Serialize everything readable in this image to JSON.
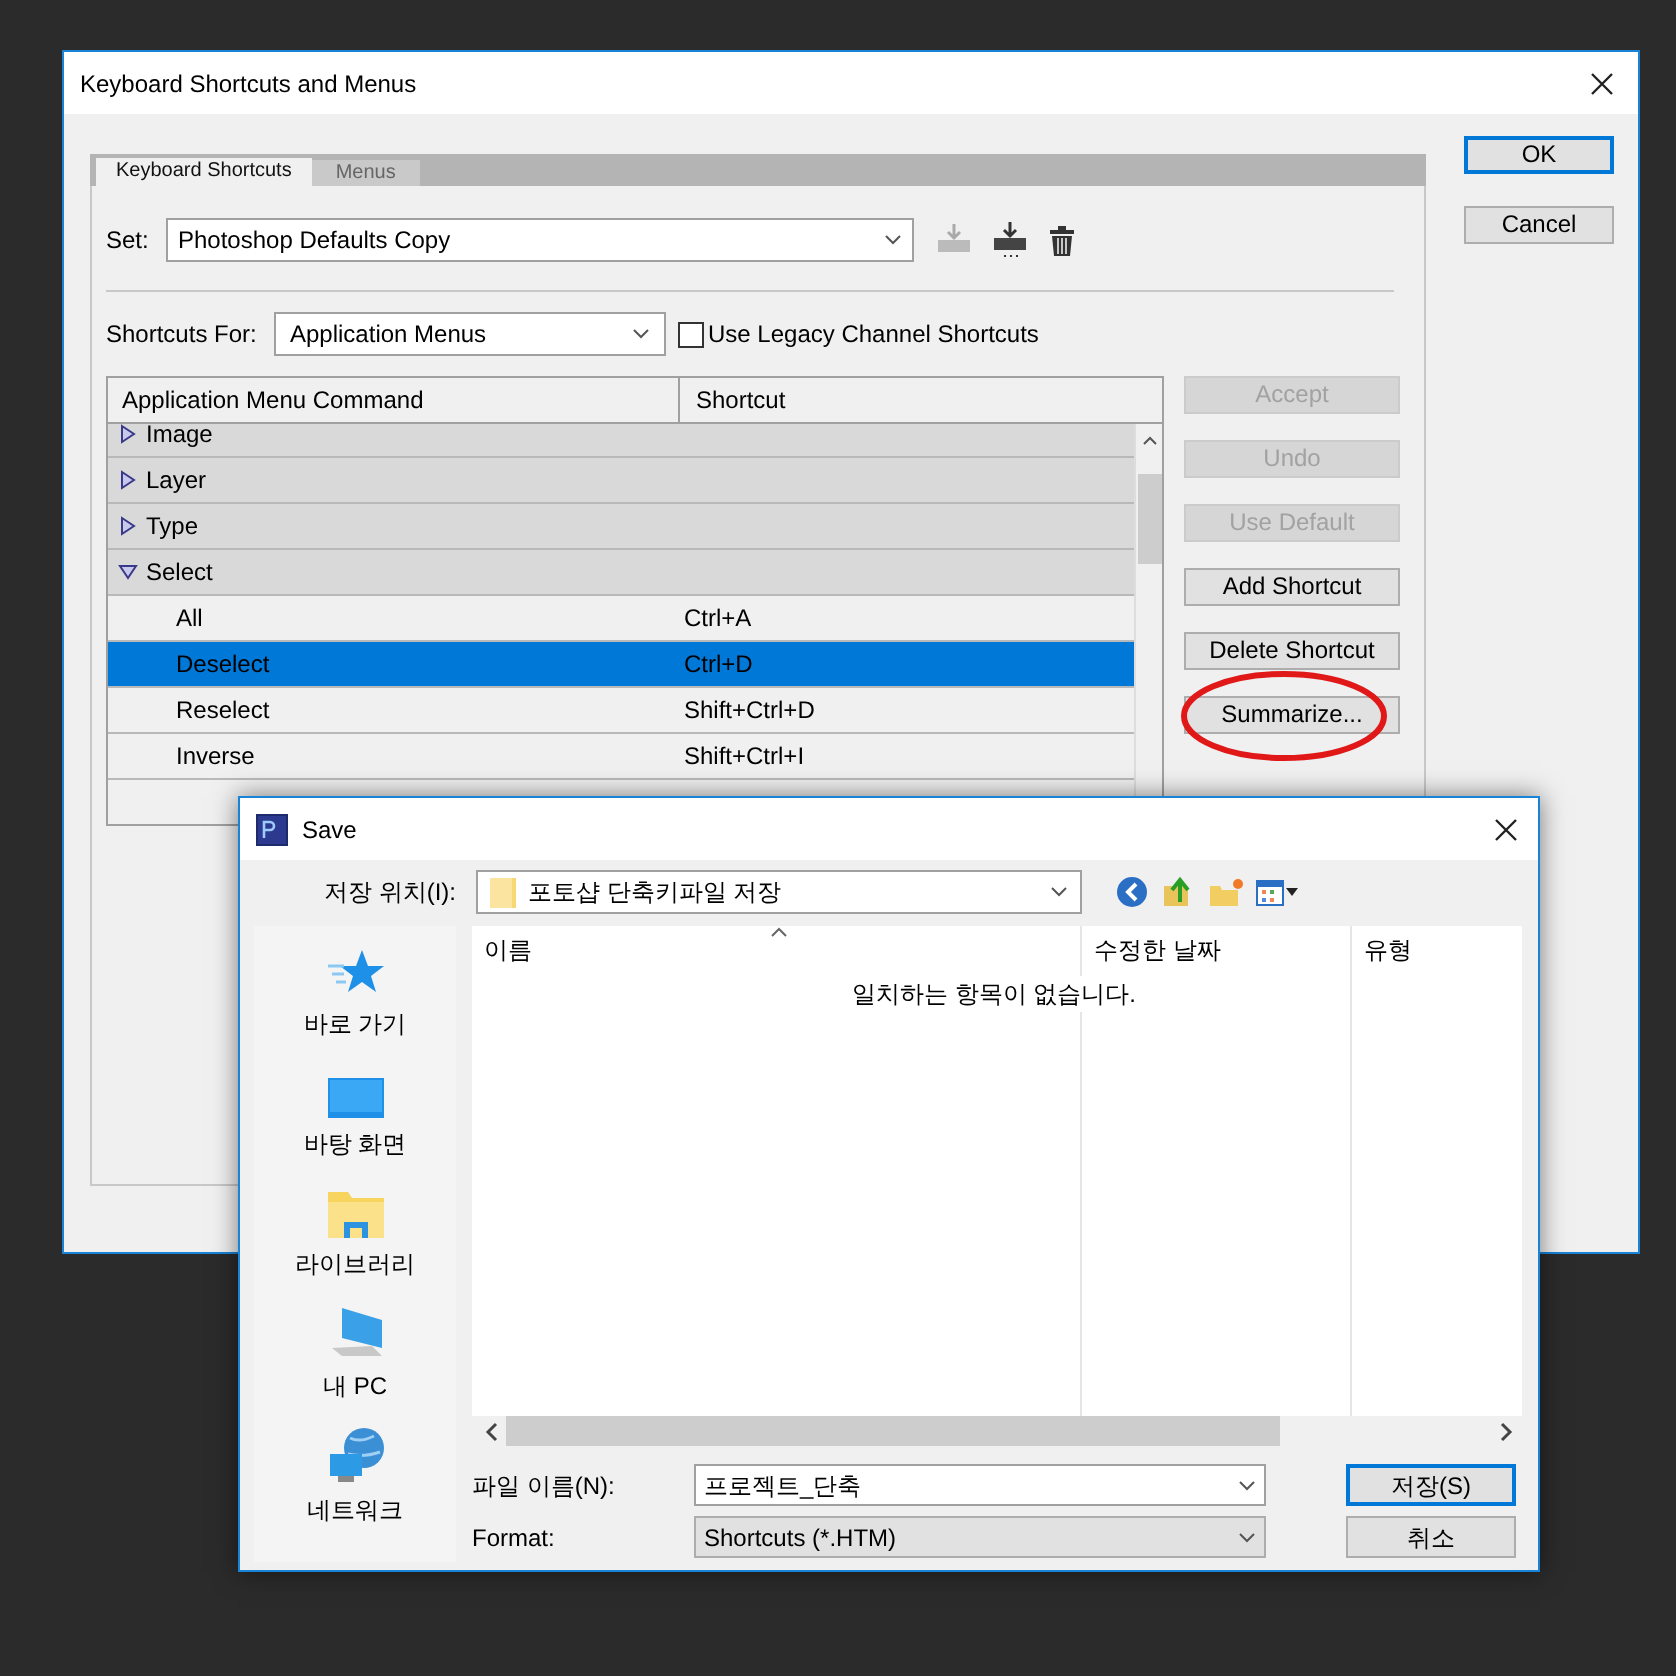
{
  "main_dialog": {
    "title": "Keyboard Shortcuts and Menus",
    "tabs": [
      {
        "label": "Keyboard Shortcuts",
        "selected": true
      },
      {
        "label": "Menus",
        "selected": false
      }
    ],
    "set": {
      "label": "Set:",
      "value": "Photoshop Defaults Copy"
    },
    "shortcuts_for": {
      "label": "Shortcuts For:",
      "value": "Application Menus"
    },
    "legacy_checkbox": {
      "label": "Use Legacy Channel Shortcuts",
      "checked": false
    },
    "table": {
      "columns": [
        "Application Menu Command",
        "Shortcut"
      ],
      "rows": [
        {
          "kind": "group",
          "command": "Image",
          "expanded": false,
          "selected": false
        },
        {
          "kind": "group",
          "command": "Layer",
          "expanded": false,
          "selected": false
        },
        {
          "kind": "group",
          "command": "Type",
          "expanded": false,
          "selected": false
        },
        {
          "kind": "group",
          "command": "Select",
          "expanded": true,
          "selected": false
        },
        {
          "kind": "item",
          "command": "All",
          "shortcut": "Ctrl+A",
          "selected": false
        },
        {
          "kind": "item",
          "command": "Deselect",
          "shortcut": "Ctrl+D",
          "selected": true
        },
        {
          "kind": "item",
          "command": "Reselect",
          "shortcut": "Shift+Ctrl+D",
          "selected": false
        },
        {
          "kind": "item",
          "command": "Inverse",
          "shortcut": "Shift+Ctrl+I",
          "selected": false
        }
      ]
    },
    "side_buttons": [
      {
        "label": "Accept",
        "disabled": true
      },
      {
        "label": "Undo",
        "disabled": true
      },
      {
        "label": "Use Default",
        "disabled": true
      },
      {
        "label": "Add Shortcut",
        "disabled": false
      },
      {
        "label": "Delete Shortcut",
        "disabled": false
      },
      {
        "label": "Summarize...",
        "disabled": false
      }
    ],
    "buttons": [
      {
        "label": "OK",
        "default": true
      },
      {
        "label": "Cancel",
        "default": false
      }
    ]
  },
  "save_dialog": {
    "title": "Save",
    "location": {
      "label": "저장 위치(I):",
      "value": "포토샵 단축키파일 저장"
    },
    "places": [
      {
        "kind": "star",
        "label": "바로 가기"
      },
      {
        "kind": "desktop",
        "label": "바탕 화면"
      },
      {
        "kind": "library",
        "label": "라이브러리"
      },
      {
        "kind": "pc",
        "label": "내 PC"
      },
      {
        "kind": "network",
        "label": "네트워크"
      }
    ],
    "columns": [
      "이름",
      "수정한 날짜",
      "유형"
    ],
    "empty_message": "일치하는 항목이 없습니다.",
    "file_name": {
      "label": "파일 이름(N):",
      "value": "프로젝트_단축"
    },
    "format": {
      "label": "Format:",
      "value": "Shortcuts (*.HTM)"
    },
    "buttons": [
      {
        "label": "저장(S)",
        "default": true
      },
      {
        "label": "취소",
        "default": false
      }
    ]
  }
}
